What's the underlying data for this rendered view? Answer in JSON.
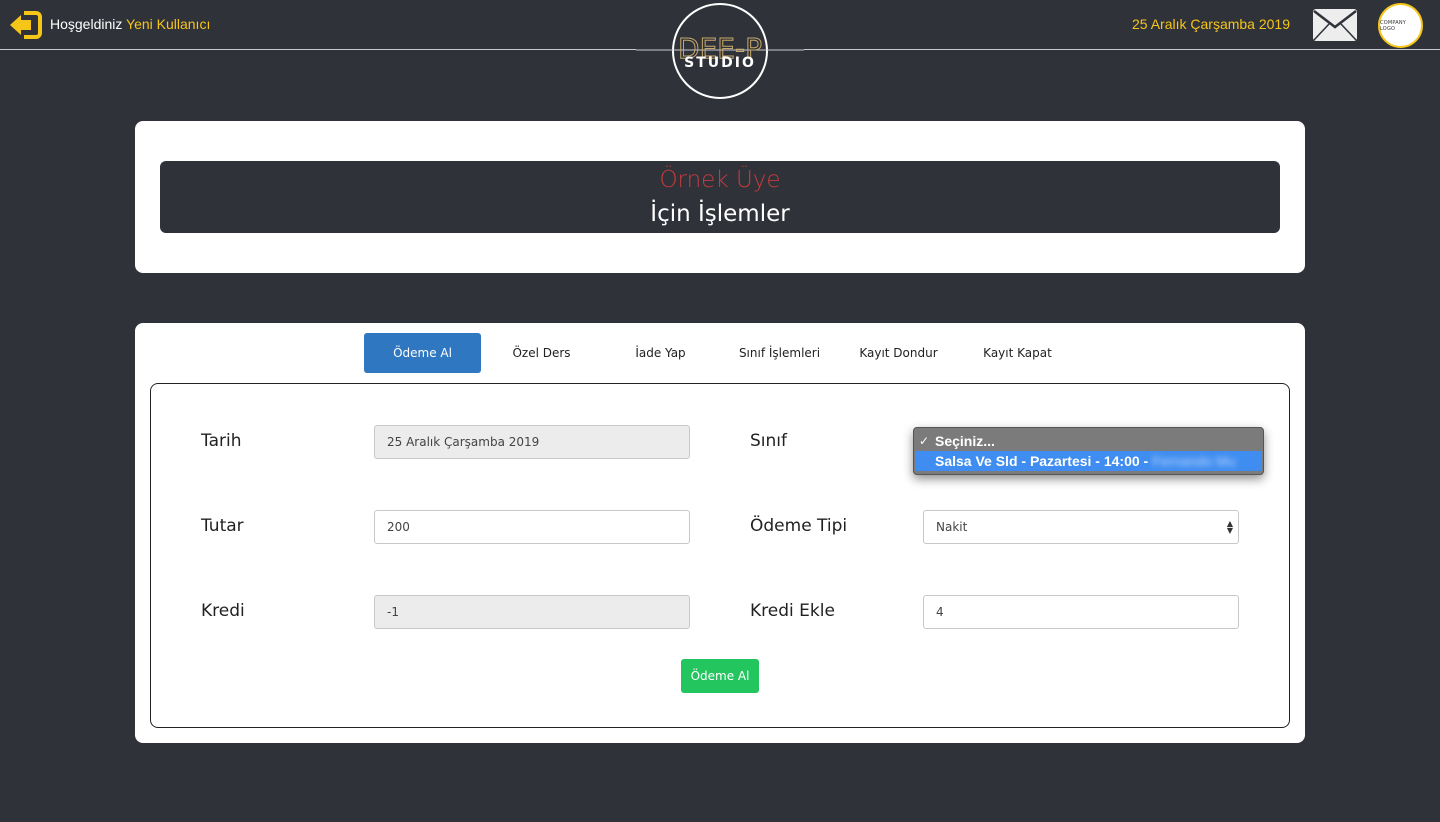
{
  "header": {
    "welcome_text": "Hoşgeldiniz",
    "user_name": "Yeni Kullanıcı",
    "date": "25 Aralık Çarşamba 2019",
    "company_logo_text": "COMPANY LOGO",
    "brand_line1": "DEE-P",
    "brand_line2": "STUDIO",
    "accent_color": "#f5c518"
  },
  "member": {
    "name": "Örnek Üye",
    "subtitle": "İçin İşlemler"
  },
  "tabs": [
    {
      "label": "Ödeme Al",
      "active": true
    },
    {
      "label": "Özel Ders",
      "active": false
    },
    {
      "label": "İade Yap",
      "active": false
    },
    {
      "label": "Sınıf İşlemleri",
      "active": false
    },
    {
      "label": "Kayıt Dondur",
      "active": false
    },
    {
      "label": "Kayıt Kapat",
      "active": false
    }
  ],
  "form": {
    "tarih_label": "Tarih",
    "tarih_value": "25 Aralık Çarşamba 2019",
    "sinif_label": "Sınıf",
    "tutar_label": "Tutar",
    "tutar_value": "200",
    "odeme_tipi_label": "Ödeme Tipi",
    "odeme_tipi_value": "Nakit",
    "kredi_label": "Kredi",
    "kredi_value": "-1",
    "kredi_ekle_label": "Kredi Ekle",
    "kredi_ekle_value": "4",
    "submit_label": "Ödeme Al"
  },
  "sinif_dropdown": {
    "options": [
      {
        "label": "Seçiniz...",
        "selected": true
      },
      {
        "label": "Salsa Ve Sld - Pazartesi - 14:00 -",
        "highlighted": true,
        "blurred_suffix": "Fernando Mu"
      }
    ]
  }
}
